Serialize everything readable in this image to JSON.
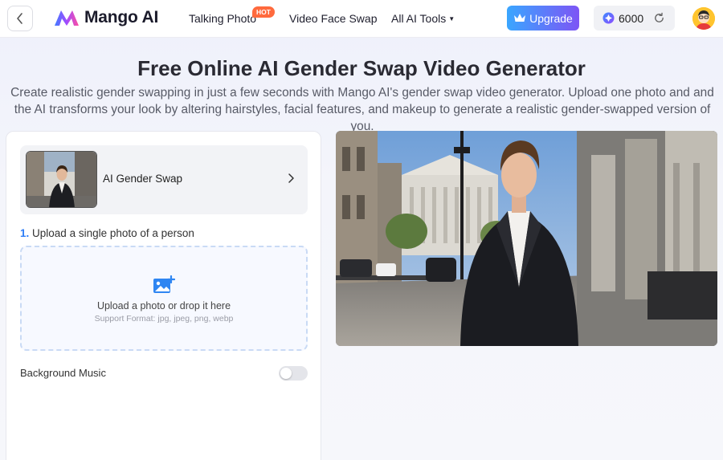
{
  "header": {
    "brand": "Mango AI",
    "nav": {
      "talking_photo": "Talking Photo",
      "hot_badge": "HOT",
      "video_face_swap": "Video Face Swap",
      "all_ai_tools": "All AI Tools"
    },
    "upgrade_label": "Upgrade",
    "credits": "6000",
    "icons": [
      "chevron-left-icon",
      "crown-icon",
      "credit-coin-icon",
      "refresh-icon",
      "user-avatar"
    ]
  },
  "hero": {
    "title": "Free Online AI Gender Swap Video Generator",
    "description": "Create realistic gender swapping in just a few seconds with Mango AI's gender swap video generator. Upload one photo and and the AI transforms your look by altering hairstyles, facial features, and makeup to generate a realistic gender-swapped version of you."
  },
  "panel": {
    "feature_label": "AI Gender Swap",
    "step_number": "1.",
    "step_label": "Upload a single photo of a person",
    "dropzone_title": "Upload a photo or drop it here",
    "dropzone_formats": "Support Format: jpg, jpeg, png, webp",
    "background_music_label": "Background Music",
    "background_music_on": false
  },
  "colors": {
    "accent_blue": "#2f7ef7",
    "upgrade_gradient_start": "#3aa6ff",
    "upgrade_gradient_end": "#7d55f5",
    "hot_badge": "#ff6a3d"
  }
}
